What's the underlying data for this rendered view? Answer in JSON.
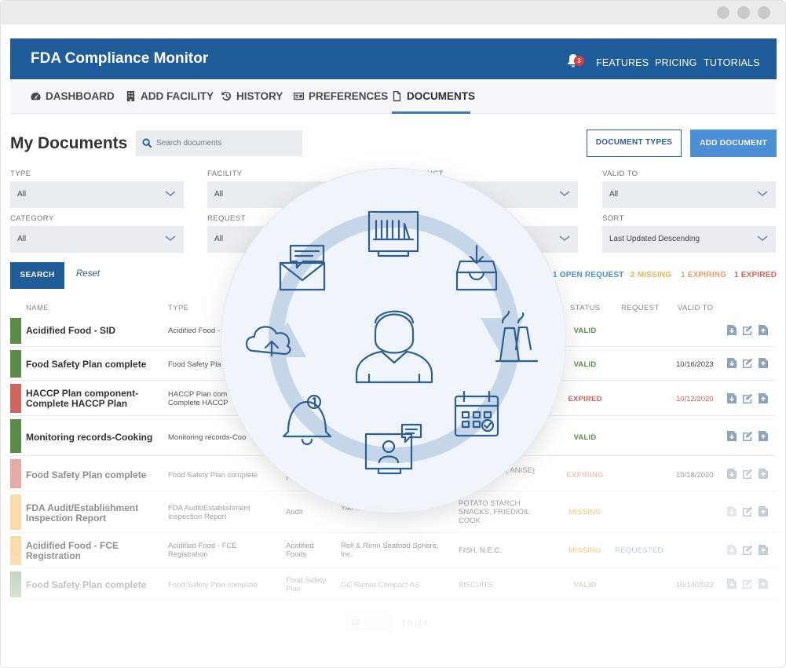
{
  "app": {
    "title": "FDA Compliance Monitor",
    "notification_count": "3"
  },
  "top_links": [
    "FEATURES",
    "PRICING",
    "TUTORIALS"
  ],
  "nav": [
    {
      "label": "DASHBOARD",
      "icon": "dashboard-icon"
    },
    {
      "label": "ADD FACILITY",
      "icon": "building-icon"
    },
    {
      "label": "HISTORY",
      "icon": "history-icon"
    },
    {
      "label": "PREFERENCES",
      "icon": "preferences-icon"
    },
    {
      "label": "DOCUMENTS",
      "icon": "document-icon",
      "active": true
    }
  ],
  "page": {
    "title": "My Documents",
    "search_placeholder": "Search documents",
    "btn_doc_types": "DOCUMENT TYPES",
    "btn_add": "ADD DOCUMENT"
  },
  "filters": {
    "type": {
      "label": "TYPE",
      "value": "All"
    },
    "facility": {
      "label": "FACILITY",
      "value": "All"
    },
    "product": {
      "label": "PRODUCT",
      "value": ""
    },
    "valid_to": {
      "label": "VALID TO",
      "value": "All"
    },
    "category": {
      "label": "CATEGORY",
      "value": "All"
    },
    "request": {
      "label": "REQUEST",
      "value": "All"
    },
    "sort": {
      "label": "SORT",
      "value": "Last Updated Descending"
    }
  },
  "actions": {
    "search": "SEARCH",
    "reset": "Reset"
  },
  "summary": {
    "open_request": "1 OPEN REQUEST",
    "missing": "2 MISSING",
    "expiring": "1 EXPIRING",
    "expired": "1 EXPIRED"
  },
  "columns": {
    "name": "NAME",
    "type": "TYPE",
    "status": "STATUS",
    "request": "REQUEST",
    "valid_to": "VALID TO"
  },
  "rows": [
    {
      "name": "Acidified Food - SID",
      "type": "Acidified Food -",
      "category": "",
      "facility": "",
      "product": "",
      "status": "VALID",
      "request": "",
      "valid_to": ""
    },
    {
      "name": "Food Safety Plan complete",
      "type": "Food Safety Pla",
      "category": "",
      "facility": "",
      "product": "",
      "status": "VALID",
      "request": "",
      "valid_to": "10/16/2023"
    },
    {
      "name": "HACCP Plan component-Complete HACCP Plan",
      "type": "HACCP Plan com Complete HACCP",
      "category": "",
      "facility": "",
      "product": "",
      "status": "EXPIRED",
      "request": "",
      "valid_to": "10/12/2020"
    },
    {
      "name": "Monitoring records-Cooking",
      "type": "Monitoring records-Coo",
      "category": "",
      "facility": "",
      "product": "",
      "status": "VALID",
      "request": "",
      "valid_to": ""
    },
    {
      "name": "Food Safety Plan complete",
      "type": "Food Safety Plan complete",
      "category": "F",
      "facility": "",
      "product": "( ANISE)",
      "status": "EXPIRING",
      "request": "",
      "valid_to": "10/18/2020"
    },
    {
      "name": "FDA Audit/Establishment Inspection Report",
      "type": "FDA Audit/Establishment Inspection Report",
      "category": "Audit",
      "facility": "Yao Marketing Ltd.",
      "product": "POTATO STARCH SNACKS, FRIED/OIL COOK",
      "status": "MISSING",
      "request": "",
      "valid_to": ""
    },
    {
      "name": "Acidified Food - FCE Registration",
      "type": "Acidified Food - FCE Registration",
      "category": "Acidified Foods",
      "facility": "Rell & Renn Seafood Sphere, Inc.",
      "product": "FISH, N.E.C.",
      "status": "MISSING",
      "request": "REQUESTED",
      "valid_to": ""
    },
    {
      "name": "Food Safety Plan complete",
      "type": "Food Safety Plan complete",
      "category": "Food Safety Plan",
      "facility": "GC Rieber Compact AS",
      "product": "BISCUITS",
      "status": "VALID",
      "request": "",
      "valid_to": "10/14/2023"
    }
  ],
  "pager": {
    "page_size": "10",
    "info": "1-8 of 8"
  },
  "colors": {
    "brand": "#1e5c9a",
    "accent": "#4b8fd6",
    "valid": "#5b8c4a",
    "expired": "#d0645e",
    "expiring": "#e3a072",
    "missing": "#f3bf63",
    "requested": "#7aa6d4"
  }
}
